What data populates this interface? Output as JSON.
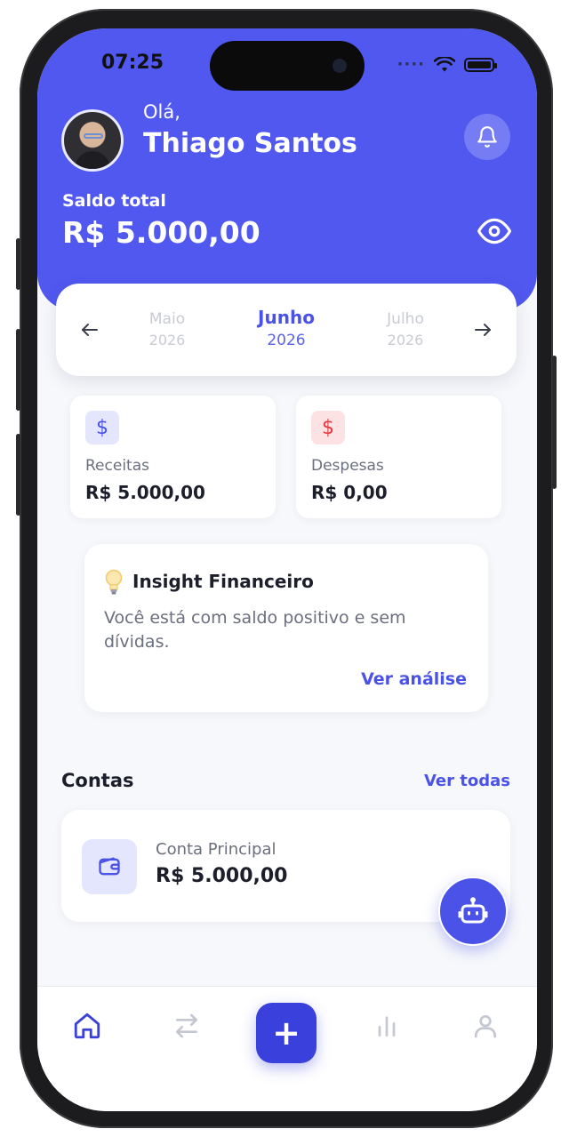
{
  "status_bar": {
    "time": "07:25"
  },
  "user": {
    "greeting": "Olá,",
    "name": "Thiago Santos"
  },
  "balance": {
    "label": "Saldo total",
    "value": "R$ 5.000,00"
  },
  "month_selector": {
    "previous": {
      "month": "Maio",
      "year": "2026"
    },
    "current": {
      "month": "Junho",
      "year": "2026"
    },
    "next": {
      "month": "Julho",
      "year": "2026"
    }
  },
  "stats": {
    "income": {
      "label": "Receitas",
      "value": "R$ 5.000,00",
      "icon": "dollar-icon",
      "color": "#4b52e8"
    },
    "expenses": {
      "label": "Despesas",
      "value": "R$ 0,00",
      "icon": "dollar-icon",
      "color": "#e5393d"
    }
  },
  "insight": {
    "title": "Insight Financeiro",
    "text": "Você está com saldo positivo e sem dívidas.",
    "link": "Ver análise",
    "icon": "lightbulb-icon"
  },
  "accounts": {
    "title": "Contas",
    "link": "Ver todas",
    "items": [
      {
        "name": "Conta Principal",
        "value": "R$ 5.000,00",
        "icon": "wallet-icon"
      }
    ]
  },
  "bottom_nav": {
    "items": [
      "home-icon",
      "transfer-icon",
      "add-icon",
      "chart-icon",
      "user-icon"
    ],
    "add_label": "+"
  },
  "colors": {
    "primary": "#5058f0",
    "accent": "#4b52e8",
    "danger": "#e5393d"
  }
}
